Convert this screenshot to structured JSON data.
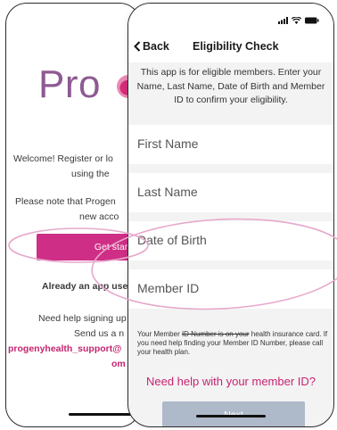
{
  "back_screen": {
    "logo_text": "Pro",
    "welcome_line1": "Welcome! Register or lo",
    "welcome_line2": "using the",
    "note_line1": "Please note that Progen",
    "note_line2": "new acco",
    "get_started": "Get start",
    "already_line": "Already an app use",
    "help_line1": "Need help signing up",
    "help_line2": "Send us a n",
    "email_line1": "progenyhealth_support@",
    "email_line2": "om"
  },
  "front_screen": {
    "back_label": "Back",
    "title": "Eligibility Check",
    "intro": "This app is for eligible members. Enter your Name, Last Name, Date of Birth and Member ID to confirm your eligibility.",
    "fields": [
      {
        "label": "First Name"
      },
      {
        "label": "Last Name"
      },
      {
        "label": "Date of Birth"
      },
      {
        "label": "Member ID"
      }
    ],
    "help_text_part1": "Your Member ",
    "help_text_strike": "ID Number is on your",
    "help_text_part2": " health insurance card. If you need help finding your Member ID Number, please call your health plan.",
    "help_link": "Need help with your member ID?",
    "next_button": "Next"
  },
  "colors": {
    "brand_pink": "#cf2e86",
    "link_pink": "#c4246f",
    "next_disabled": "#aeb9c9",
    "highlight_ring": "#e6a9cc"
  },
  "icons": [
    "signal-icon",
    "wifi-icon",
    "battery-icon",
    "chevron-left-icon"
  ]
}
